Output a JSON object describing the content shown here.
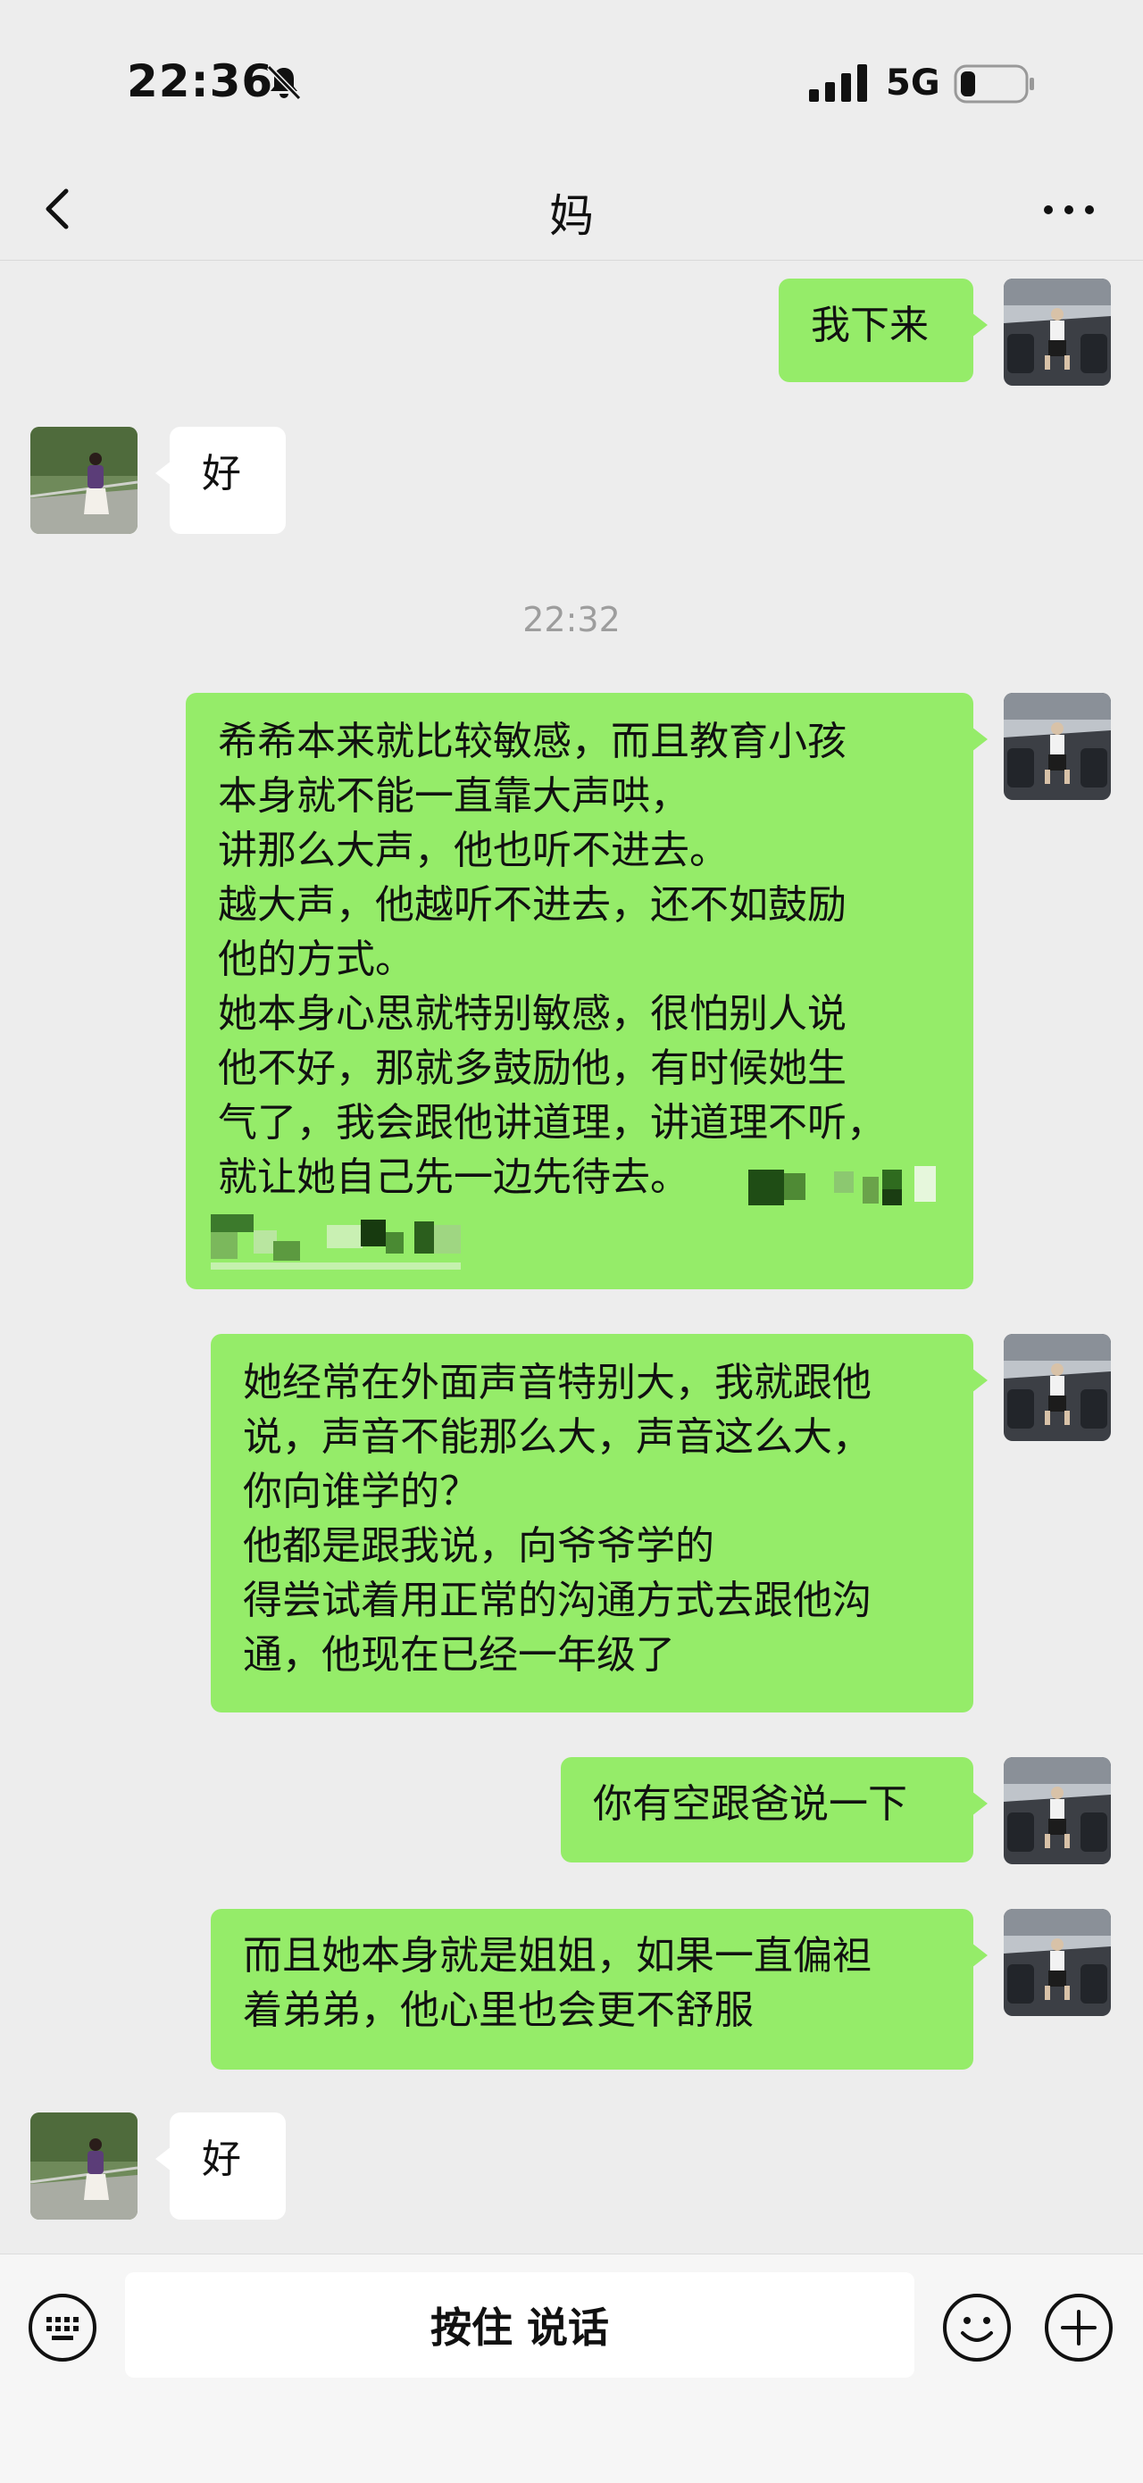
{
  "status_bar": {
    "time": "22:36",
    "network": "5G"
  },
  "nav": {
    "title": "妈"
  },
  "timestamp": "22:32",
  "messages": {
    "m1": {
      "lines": [
        "我下来"
      ]
    },
    "m2": {
      "lines": [
        "好"
      ]
    },
    "m3": {
      "lines": [
        "希希本来就比较敏感，而且教育小孩",
        "本身就不能一直靠大声哄，",
        "讲那么大声，他也听不进去。",
        "越大声，他越听不进去，还不如鼓励",
        "他的方式。",
        "她本身心思就特别敏感，很怕别人说",
        "他不好，那就多鼓励他，有时候她生",
        "气了，我会跟他讲道理，讲道理不听，",
        "就让她自己先一边先待去。"
      ]
    },
    "m4": {
      "lines": [
        "她经常在外面声音特别大，我就跟他",
        "说，声音不能那么大，声音这么大，",
        "你向谁学的？",
        "他都是跟我说，向爷爷学的",
        "得尝试着用正常的沟通方式去跟他沟",
        "通，他现在已经一年级了"
      ]
    },
    "m5": {
      "lines": [
        "你有空跟爸说一下"
      ]
    },
    "m6": {
      "lines": [
        "而且她本身就是姐姐，如果一直偏袒",
        "着弟弟，他心里也会更不舒服"
      ]
    },
    "m7": {
      "lines": [
        "好"
      ]
    }
  },
  "input_bar": {
    "hold_to_talk": "按住 说话"
  },
  "icons": {
    "back": "chevron-left-icon",
    "more": "more-dots-icon",
    "voice": "keyboard-icon",
    "emoji": "emoji-icon",
    "plus": "plus-icon"
  },
  "colors": {
    "outgoing_bubble": "#95ec69",
    "incoming_bubble": "#ffffff",
    "background": "#ededed"
  }
}
